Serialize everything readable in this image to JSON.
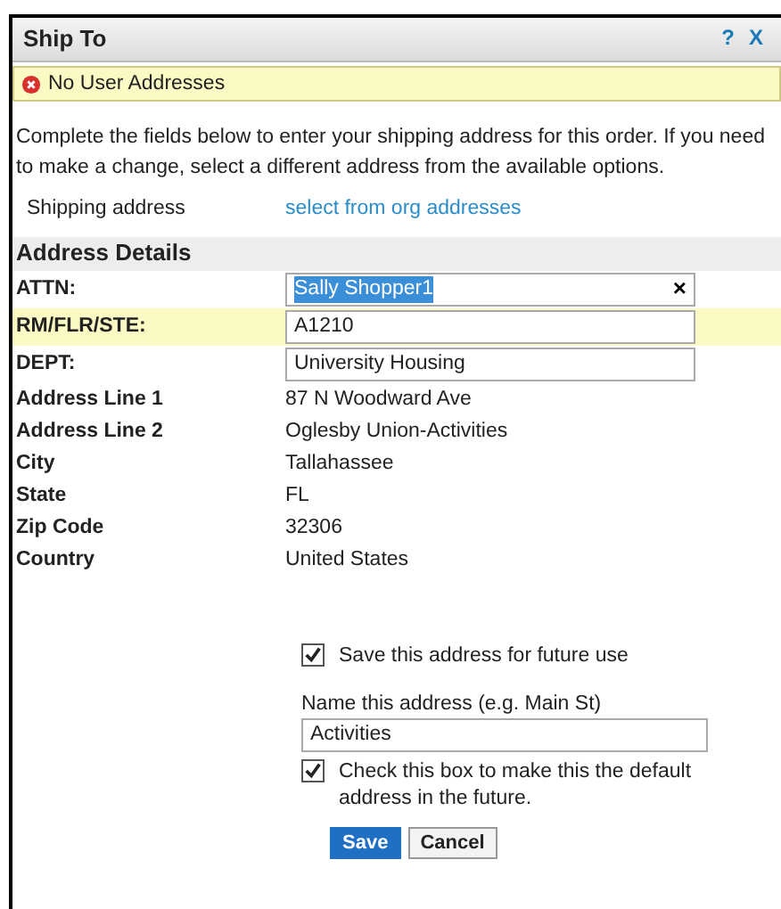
{
  "window": {
    "title": "Ship To",
    "help": "?",
    "close": "X"
  },
  "alert": {
    "text": "No User Addresses"
  },
  "intro": "Complete the fields below to enter your shipping address for this order. If you need to make a change, select a different address from the available options.",
  "shipping_address": {
    "label": "Shipping address",
    "link": "select from org addresses"
  },
  "section_title": "Address Details",
  "fields": [
    {
      "kind": "input",
      "label": "ATTN:",
      "value": "Sally Shopper1",
      "text_selected": true,
      "clear": "×",
      "highlighted": false
    },
    {
      "kind": "input",
      "label": "RM/FLR/STE:",
      "value": "A1210",
      "text_selected": false,
      "highlighted": true
    },
    {
      "kind": "input",
      "label": "DEPT:",
      "value": "University Housing",
      "text_selected": false,
      "highlighted": false
    },
    {
      "kind": "text",
      "label": "Address Line 1",
      "value": "87 N Woodward Ave"
    },
    {
      "kind": "text",
      "label": "Address Line 2",
      "value": "Oglesby Union-Activities"
    },
    {
      "kind": "text",
      "label": "City",
      "value": "Tallahassee"
    },
    {
      "kind": "text",
      "label": "State",
      "value": "FL"
    },
    {
      "kind": "text",
      "label": "Zip Code",
      "value": "32306"
    },
    {
      "kind": "text",
      "label": "Country",
      "value": "United States"
    }
  ],
  "save_checkbox": {
    "label": "Save this address for future use",
    "checked": true
  },
  "name_field": {
    "label": "Name this address (e.g. Main St)",
    "value": "Activities"
  },
  "default_checkbox": {
    "label": "Check this box to make this the default address in the future.",
    "checked": true
  },
  "buttons": [
    {
      "kind": "primary",
      "label": "Save"
    },
    {
      "kind": "secondary",
      "label": "Cancel"
    }
  ]
}
